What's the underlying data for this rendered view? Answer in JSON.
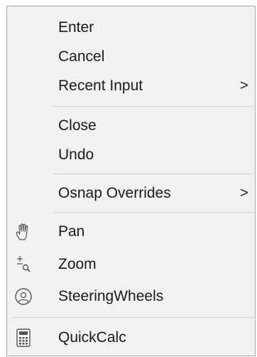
{
  "menu": {
    "enter": "Enter",
    "cancel": "Cancel",
    "recent_input": "Recent Input",
    "close": "Close",
    "undo": "Undo",
    "osnap_overrides": "Osnap Overrides",
    "pan": "Pan",
    "zoom": "Zoom",
    "steering_wheels": "SteeringWheels",
    "quickcalc": "QuickCalc",
    "submenu_arrow": ">"
  },
  "icons": {
    "pan": "hand-icon",
    "zoom": "zoom-icon",
    "steering_wheels": "steering-wheel-icon",
    "quickcalc": "calculator-icon"
  }
}
